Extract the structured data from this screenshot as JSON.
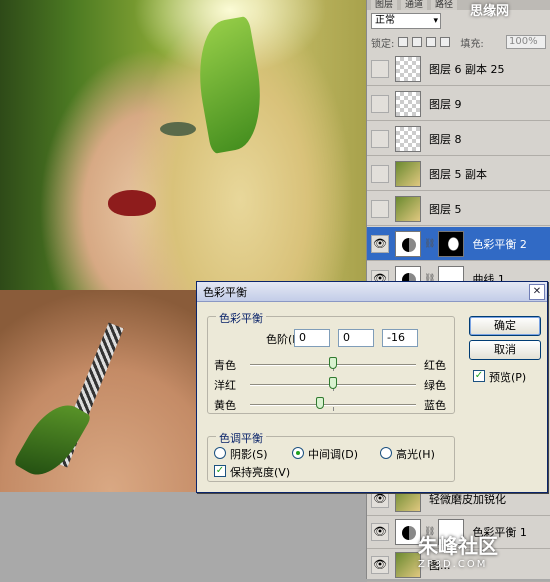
{
  "panel_tabs": [
    "图层",
    "通道",
    "路径"
  ],
  "blend_mode": "正常",
  "lock_label": "锁定:",
  "fill_label": "填充:",
  "fill_value": "100%",
  "layers": [
    {
      "name": "图层 6 副本 25",
      "thumb": "transparent",
      "visible": false
    },
    {
      "name": "图层 9",
      "thumb": "transparent",
      "visible": false
    },
    {
      "name": "图层 8",
      "thumb": "transparent",
      "visible": false
    },
    {
      "name": "图层 5 副本",
      "thumb": "photo",
      "visible": false
    },
    {
      "name": "图层 5",
      "thumb": "photo",
      "visible": false
    },
    {
      "name": "色彩平衡 2",
      "thumb": "adjust",
      "visible": true,
      "selected": true
    },
    {
      "name": "曲线 1",
      "thumb": "curves",
      "visible": true
    }
  ],
  "lower_layers": [
    {
      "name": "轻微磨皮加锐化",
      "thumb": "photo",
      "visible": true
    },
    {
      "name": "色彩平衡 1",
      "thumb": "adjust",
      "visible": true
    },
    {
      "name": "图...",
      "thumb": "photo",
      "visible": true
    }
  ],
  "dialog": {
    "title": "色彩平衡",
    "close": "✕",
    "color_balance_group": "色彩平衡",
    "levels_label": "色阶(L):",
    "levels": [
      "0",
      "0",
      "-16"
    ],
    "sliders": [
      {
        "left": "青色",
        "right": "红色",
        "value": 0
      },
      {
        "left": "洋红",
        "right": "绿色",
        "value": 0
      },
      {
        "left": "黄色",
        "right": "蓝色",
        "value": -16
      }
    ],
    "tone_group": "色调平衡",
    "tones": [
      {
        "label": "阴影(S)",
        "checked": false
      },
      {
        "label": "中间调(D)",
        "checked": true
      },
      {
        "label": "高光(H)",
        "checked": false
      }
    ],
    "preserve_luminosity": "保持亮度(V)",
    "ok": "确定",
    "cancel": "取消",
    "preview": "预览(P)"
  },
  "watermark_top": "思缘网",
  "watermark_bottom": {
    "main": "朱峰社区",
    "sub": "ZF3D.COM"
  }
}
